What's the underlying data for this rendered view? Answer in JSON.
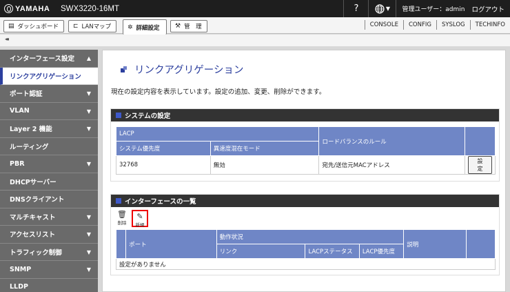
{
  "header": {
    "brand": "YAMAHA",
    "model": "SWX3220-16MT",
    "help": "?",
    "user_label": "管理ユーザー：admin",
    "logout": "ログアウト"
  },
  "tabs": [
    {
      "label": "ダッシュボード",
      "icon": "dashboard-icon"
    },
    {
      "label": "LANマップ",
      "icon": "lan-map-icon"
    },
    {
      "label": "詳細設定",
      "icon": "gear-icon"
    },
    {
      "label": "管　理",
      "icon": "wrench-icon"
    }
  ],
  "links": [
    "CONSOLE",
    "CONFIG",
    "SYSLOG",
    "TECHINFO"
  ],
  "collapse": "◂◂",
  "sidebar": {
    "items": [
      {
        "label": "インターフェース設定",
        "arrow": "▲"
      },
      {
        "label": "リンクアグリゲーション",
        "arrow": ""
      },
      {
        "label": "ポート認証",
        "arrow": "▼"
      },
      {
        "label": "VLAN",
        "arrow": "▼"
      },
      {
        "label": "Layer 2 機能",
        "arrow": "▼"
      },
      {
        "label": "ルーティング",
        "arrow": ""
      },
      {
        "label": "PBR",
        "arrow": "▼"
      },
      {
        "label": "DHCPサーバー",
        "arrow": ""
      },
      {
        "label": "DNSクライアント",
        "arrow": ""
      },
      {
        "label": "マルチキャスト",
        "arrow": "▼"
      },
      {
        "label": "アクセスリスト",
        "arrow": "▼"
      },
      {
        "label": "トラフィック制御",
        "arrow": "▼"
      },
      {
        "label": "SNMP",
        "arrow": "▼"
      },
      {
        "label": "LLDP",
        "arrow": ""
      }
    ]
  },
  "main": {
    "title": "リンクアグリゲーション",
    "description": "現在の設定内容を表示しています。設定の追加、変更、削除ができます。",
    "system_panel": {
      "heading": "システムの設定",
      "col_lacp": "LACP",
      "col_priority": "システム優先度",
      "col_mixed": "異速度混在モード",
      "col_lb": "ロードバランスのルール",
      "row": {
        "priority": "32768",
        "mixed": "無効",
        "lb": "宛先/送信元MACアドレス",
        "button": "設定"
      }
    },
    "interface_panel": {
      "heading": "インターフェースの一覧",
      "delete_label": "削除",
      "new_label": "新規",
      "col_port": "ポート",
      "col_status": "動作状況",
      "col_link": "リンク",
      "col_lacp_status": "LACPステータス",
      "col_lacp_priority": "LACP優先度",
      "col_desc": "説明",
      "empty": "設定がありません"
    }
  }
}
